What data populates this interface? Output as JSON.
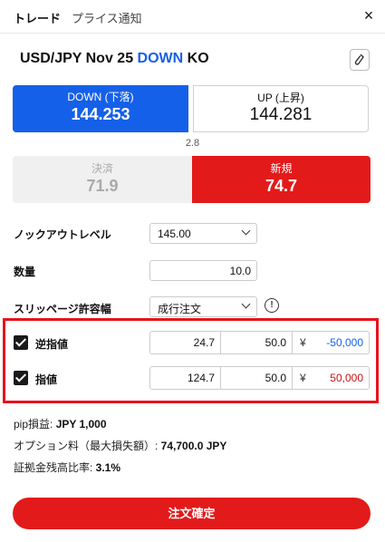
{
  "tabs": [
    {
      "label": "トレード",
      "active": true
    },
    {
      "label": "プライス通知",
      "active": false
    }
  ],
  "close_glyph": "×",
  "instrument": {
    "pair_expiry": "USD/JPY Nov 25",
    "direction": "DOWN",
    "suffix": "KO"
  },
  "quotes": {
    "down": {
      "label": "DOWN (下落)",
      "value": "144.253"
    },
    "up": {
      "label": "UP (上昇)",
      "value": "144.281"
    },
    "spread": "2.8"
  },
  "sides": {
    "settle": {
      "label": "決済",
      "value": "71.9"
    },
    "new": {
      "label": "新規",
      "value": "74.7"
    }
  },
  "form": {
    "knockout_label": "ノックアウトレベル",
    "knockout_value": "145.00",
    "quantity_label": "数量",
    "quantity_value": "10.0",
    "slippage_label": "スリッページ許容幅",
    "slippage_value": "成行注文",
    "info_glyph": "!"
  },
  "orders": [
    {
      "label": "逆指値",
      "price": "24.7",
      "pips": "50.0",
      "currency": "¥",
      "amount": "-50,000",
      "amount_color": "#1560e8",
      "checked": true
    },
    {
      "label": "指値",
      "price": "124.7",
      "pips": "50.0",
      "currency": "¥",
      "amount": "50,000",
      "amount_color": "#cc1111",
      "checked": true
    }
  ],
  "summary": {
    "pip_label": "pip損益: ",
    "pip_value": "JPY 1,000",
    "option_label": "オプション料（最大損失額）: ",
    "option_value": "74,700.0 JPY",
    "margin_label": "証拠金残高比率: ",
    "margin_value": "3.1%"
  },
  "order_button": "注文確定",
  "colors": {
    "accent_blue": "#1560e8",
    "accent_red": "#e31a1a",
    "highlight_box": "#e8121c"
  },
  "icons": {
    "close": "close-icon",
    "link": "link-icon",
    "dropdown": "chevron-down-icon",
    "info": "info-icon",
    "checkbox": "checkbox-checked-icon"
  }
}
